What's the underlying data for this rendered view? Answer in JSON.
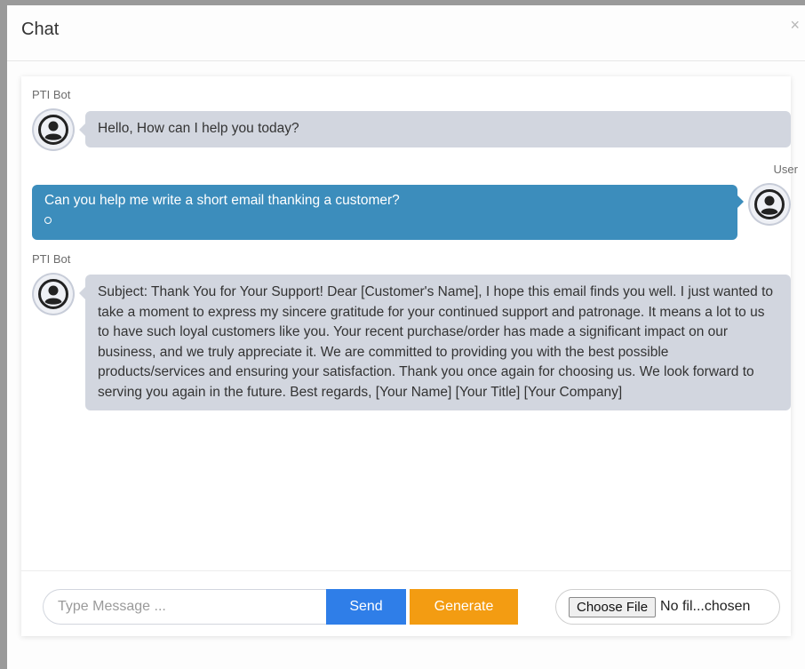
{
  "modal": {
    "title": "Chat",
    "close_symbol": "×"
  },
  "messages": [
    {
      "sender": "PTI Bot",
      "role": "bot",
      "avatar_icon": "user-avatar-icon",
      "text": "Hello, How can I help you today?"
    },
    {
      "sender": "User",
      "role": "user",
      "avatar_icon": "user-avatar-icon",
      "text": "Can you help me write a short email thanking a customer?"
    },
    {
      "sender": "PTI Bot",
      "role": "bot",
      "avatar_icon": "user-avatar-icon",
      "text": "Subject: Thank You for Your Support! Dear [Customer's Name], I hope this email finds you well. I just wanted to take a moment to express my sincere gratitude for your continued support and patronage. It means a lot to us to have such loyal customers like you. Your recent purchase/order has made a significant impact on our business, and we truly appreciate it. We are committed to providing you with the best possible products/services and ensuring your satisfaction. Thank you once again for choosing us. We look forward to serving you again in the future. Best regards, [Your Name] [Your Title] [Your Company]"
    }
  ],
  "footer": {
    "input_placeholder": "Type Message ...",
    "input_value": "",
    "send_label": "Send",
    "generate_label": "Generate",
    "file_button_label": "Choose File",
    "file_status": "No fil...chosen"
  },
  "colors": {
    "bot_bubble": "#d2d6df",
    "user_bubble": "#3c8dbc",
    "send_button": "#2f7ee8",
    "generate_button": "#f39c12"
  }
}
